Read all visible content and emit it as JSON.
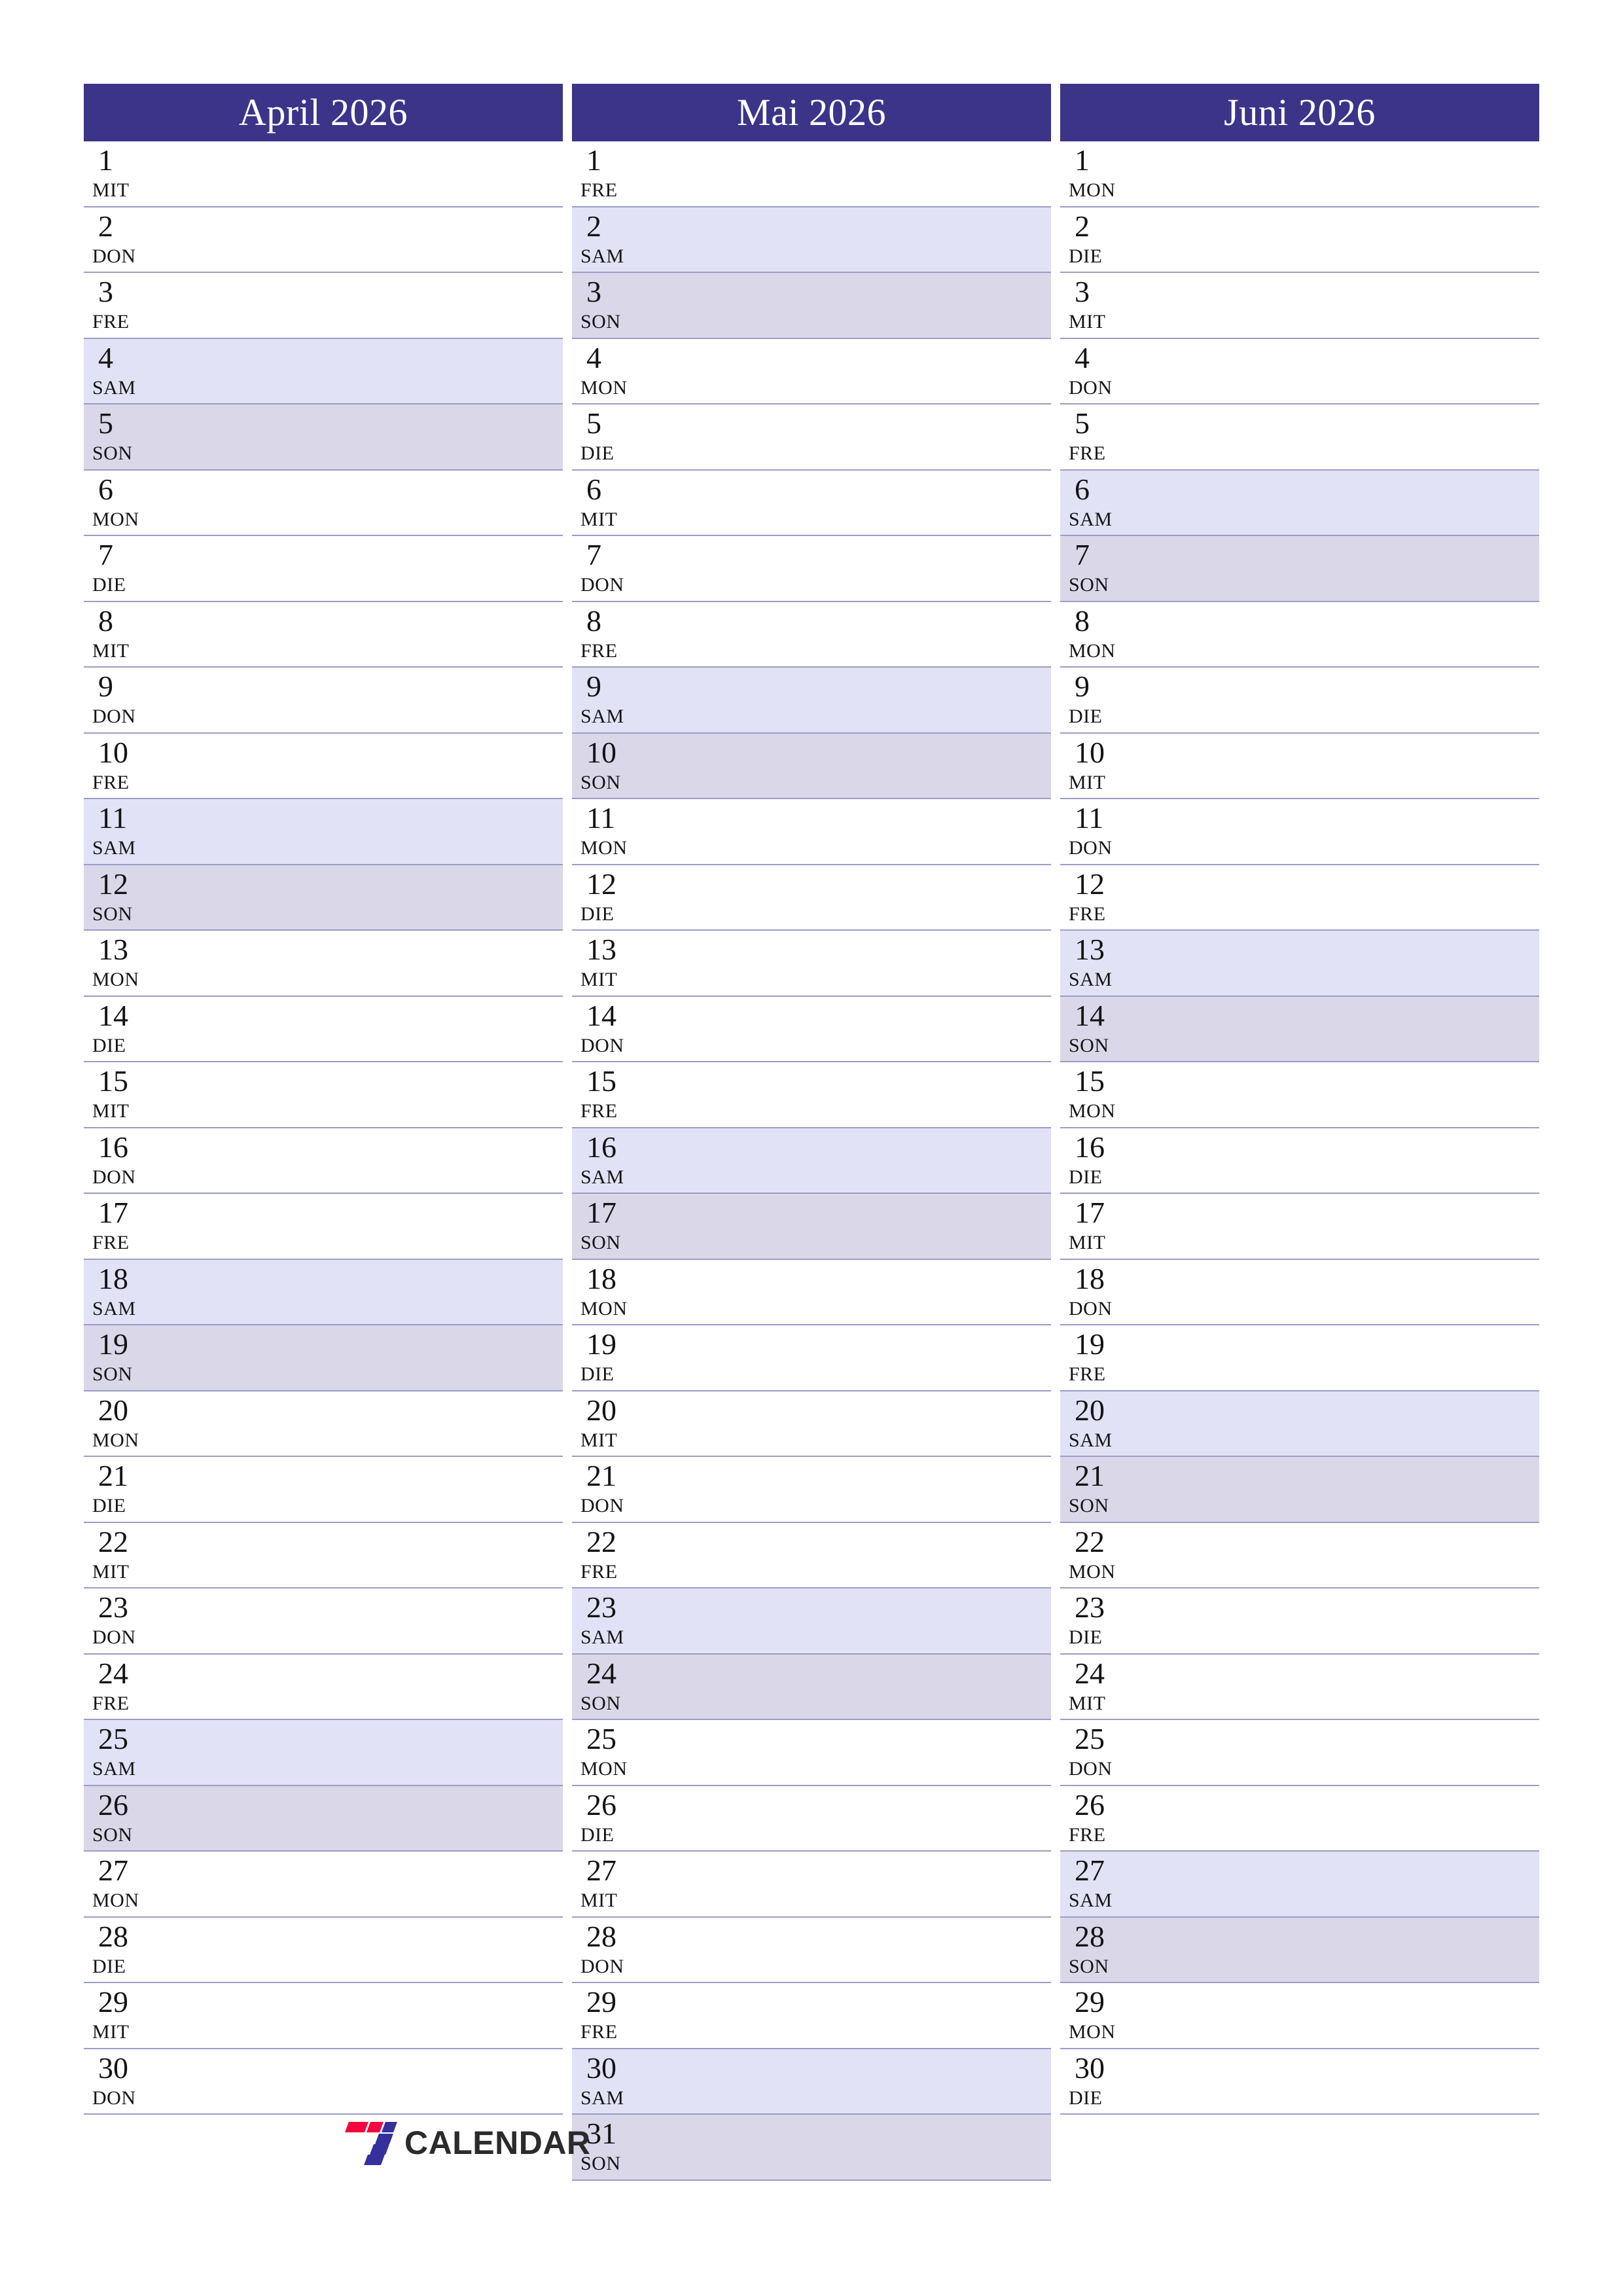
{
  "page": {
    "background_color": "#ffffff",
    "header_color": "#3b3489",
    "saturday_color": "#e2e2f6",
    "sunday_color": "#dad7e9",
    "separator_color": "#9c9cc6",
    "text_color": "#141414"
  },
  "brand": {
    "name": "CALENDAR",
    "logo_accent_red": "#f5053d",
    "logo_accent_blue": "#36309a"
  },
  "months": [
    {
      "title": "April 2026",
      "days": [
        {
          "num": "1",
          "weekday": "MIT",
          "type": "weekday"
        },
        {
          "num": "2",
          "weekday": "DON",
          "type": "weekday"
        },
        {
          "num": "3",
          "weekday": "FRE",
          "type": "weekday"
        },
        {
          "num": "4",
          "weekday": "SAM",
          "type": "sat"
        },
        {
          "num": "5",
          "weekday": "SON",
          "type": "sun"
        },
        {
          "num": "6",
          "weekday": "MON",
          "type": "weekday"
        },
        {
          "num": "7",
          "weekday": "DIE",
          "type": "weekday"
        },
        {
          "num": "8",
          "weekday": "MIT",
          "type": "weekday"
        },
        {
          "num": "9",
          "weekday": "DON",
          "type": "weekday"
        },
        {
          "num": "10",
          "weekday": "FRE",
          "type": "weekday"
        },
        {
          "num": "11",
          "weekday": "SAM",
          "type": "sat"
        },
        {
          "num": "12",
          "weekday": "SON",
          "type": "sun"
        },
        {
          "num": "13",
          "weekday": "MON",
          "type": "weekday"
        },
        {
          "num": "14",
          "weekday": "DIE",
          "type": "weekday"
        },
        {
          "num": "15",
          "weekday": "MIT",
          "type": "weekday"
        },
        {
          "num": "16",
          "weekday": "DON",
          "type": "weekday"
        },
        {
          "num": "17",
          "weekday": "FRE",
          "type": "weekday"
        },
        {
          "num": "18",
          "weekday": "SAM",
          "type": "sat"
        },
        {
          "num": "19",
          "weekday": "SON",
          "type": "sun"
        },
        {
          "num": "20",
          "weekday": "MON",
          "type": "weekday"
        },
        {
          "num": "21",
          "weekday": "DIE",
          "type": "weekday"
        },
        {
          "num": "22",
          "weekday": "MIT",
          "type": "weekday"
        },
        {
          "num": "23",
          "weekday": "DON",
          "type": "weekday"
        },
        {
          "num": "24",
          "weekday": "FRE",
          "type": "weekday"
        },
        {
          "num": "25",
          "weekday": "SAM",
          "type": "sat"
        },
        {
          "num": "26",
          "weekday": "SON",
          "type": "sun"
        },
        {
          "num": "27",
          "weekday": "MON",
          "type": "weekday"
        },
        {
          "num": "28",
          "weekday": "DIE",
          "type": "weekday"
        },
        {
          "num": "29",
          "weekday": "MIT",
          "type": "weekday"
        },
        {
          "num": "30",
          "weekday": "DON",
          "type": "weekday"
        }
      ]
    },
    {
      "title": "Mai 2026",
      "days": [
        {
          "num": "1",
          "weekday": "FRE",
          "type": "weekday"
        },
        {
          "num": "2",
          "weekday": "SAM",
          "type": "sat"
        },
        {
          "num": "3",
          "weekday": "SON",
          "type": "sun"
        },
        {
          "num": "4",
          "weekday": "MON",
          "type": "weekday"
        },
        {
          "num": "5",
          "weekday": "DIE",
          "type": "weekday"
        },
        {
          "num": "6",
          "weekday": "MIT",
          "type": "weekday"
        },
        {
          "num": "7",
          "weekday": "DON",
          "type": "weekday"
        },
        {
          "num": "8",
          "weekday": "FRE",
          "type": "weekday"
        },
        {
          "num": "9",
          "weekday": "SAM",
          "type": "sat"
        },
        {
          "num": "10",
          "weekday": "SON",
          "type": "sun"
        },
        {
          "num": "11",
          "weekday": "MON",
          "type": "weekday"
        },
        {
          "num": "12",
          "weekday": "DIE",
          "type": "weekday"
        },
        {
          "num": "13",
          "weekday": "MIT",
          "type": "weekday"
        },
        {
          "num": "14",
          "weekday": "DON",
          "type": "weekday"
        },
        {
          "num": "15",
          "weekday": "FRE",
          "type": "weekday"
        },
        {
          "num": "16",
          "weekday": "SAM",
          "type": "sat"
        },
        {
          "num": "17",
          "weekday": "SON",
          "type": "sun"
        },
        {
          "num": "18",
          "weekday": "MON",
          "type": "weekday"
        },
        {
          "num": "19",
          "weekday": "DIE",
          "type": "weekday"
        },
        {
          "num": "20",
          "weekday": "MIT",
          "type": "weekday"
        },
        {
          "num": "21",
          "weekday": "DON",
          "type": "weekday"
        },
        {
          "num": "22",
          "weekday": "FRE",
          "type": "weekday"
        },
        {
          "num": "23",
          "weekday": "SAM",
          "type": "sat"
        },
        {
          "num": "24",
          "weekday": "SON",
          "type": "sun"
        },
        {
          "num": "25",
          "weekday": "MON",
          "type": "weekday"
        },
        {
          "num": "26",
          "weekday": "DIE",
          "type": "weekday"
        },
        {
          "num": "27",
          "weekday": "MIT",
          "type": "weekday"
        },
        {
          "num": "28",
          "weekday": "DON",
          "type": "weekday"
        },
        {
          "num": "29",
          "weekday": "FRE",
          "type": "weekday"
        },
        {
          "num": "30",
          "weekday": "SAM",
          "type": "sat"
        },
        {
          "num": "31",
          "weekday": "SON",
          "type": "sun"
        }
      ]
    },
    {
      "title": "Juni 2026",
      "days": [
        {
          "num": "1",
          "weekday": "MON",
          "type": "weekday"
        },
        {
          "num": "2",
          "weekday": "DIE",
          "type": "weekday"
        },
        {
          "num": "3",
          "weekday": "MIT",
          "type": "weekday"
        },
        {
          "num": "4",
          "weekday": "DON",
          "type": "weekday"
        },
        {
          "num": "5",
          "weekday": "FRE",
          "type": "weekday"
        },
        {
          "num": "6",
          "weekday": "SAM",
          "type": "sat"
        },
        {
          "num": "7",
          "weekday": "SON",
          "type": "sun"
        },
        {
          "num": "8",
          "weekday": "MON",
          "type": "weekday"
        },
        {
          "num": "9",
          "weekday": "DIE",
          "type": "weekday"
        },
        {
          "num": "10",
          "weekday": "MIT",
          "type": "weekday"
        },
        {
          "num": "11",
          "weekday": "DON",
          "type": "weekday"
        },
        {
          "num": "12",
          "weekday": "FRE",
          "type": "weekday"
        },
        {
          "num": "13",
          "weekday": "SAM",
          "type": "sat"
        },
        {
          "num": "14",
          "weekday": "SON",
          "type": "sun"
        },
        {
          "num": "15",
          "weekday": "MON",
          "type": "weekday"
        },
        {
          "num": "16",
          "weekday": "DIE",
          "type": "weekday"
        },
        {
          "num": "17",
          "weekday": "MIT",
          "type": "weekday"
        },
        {
          "num": "18",
          "weekday": "DON",
          "type": "weekday"
        },
        {
          "num": "19",
          "weekday": "FRE",
          "type": "weekday"
        },
        {
          "num": "20",
          "weekday": "SAM",
          "type": "sat"
        },
        {
          "num": "21",
          "weekday": "SON",
          "type": "sun"
        },
        {
          "num": "22",
          "weekday": "MON",
          "type": "weekday"
        },
        {
          "num": "23",
          "weekday": "DIE",
          "type": "weekday"
        },
        {
          "num": "24",
          "weekday": "MIT",
          "type": "weekday"
        },
        {
          "num": "25",
          "weekday": "DON",
          "type": "weekday"
        },
        {
          "num": "26",
          "weekday": "FRE",
          "type": "weekday"
        },
        {
          "num": "27",
          "weekday": "SAM",
          "type": "sat"
        },
        {
          "num": "28",
          "weekday": "SON",
          "type": "sun"
        },
        {
          "num": "29",
          "weekday": "MON",
          "type": "weekday"
        },
        {
          "num": "30",
          "weekday": "DIE",
          "type": "weekday"
        }
      ]
    }
  ]
}
